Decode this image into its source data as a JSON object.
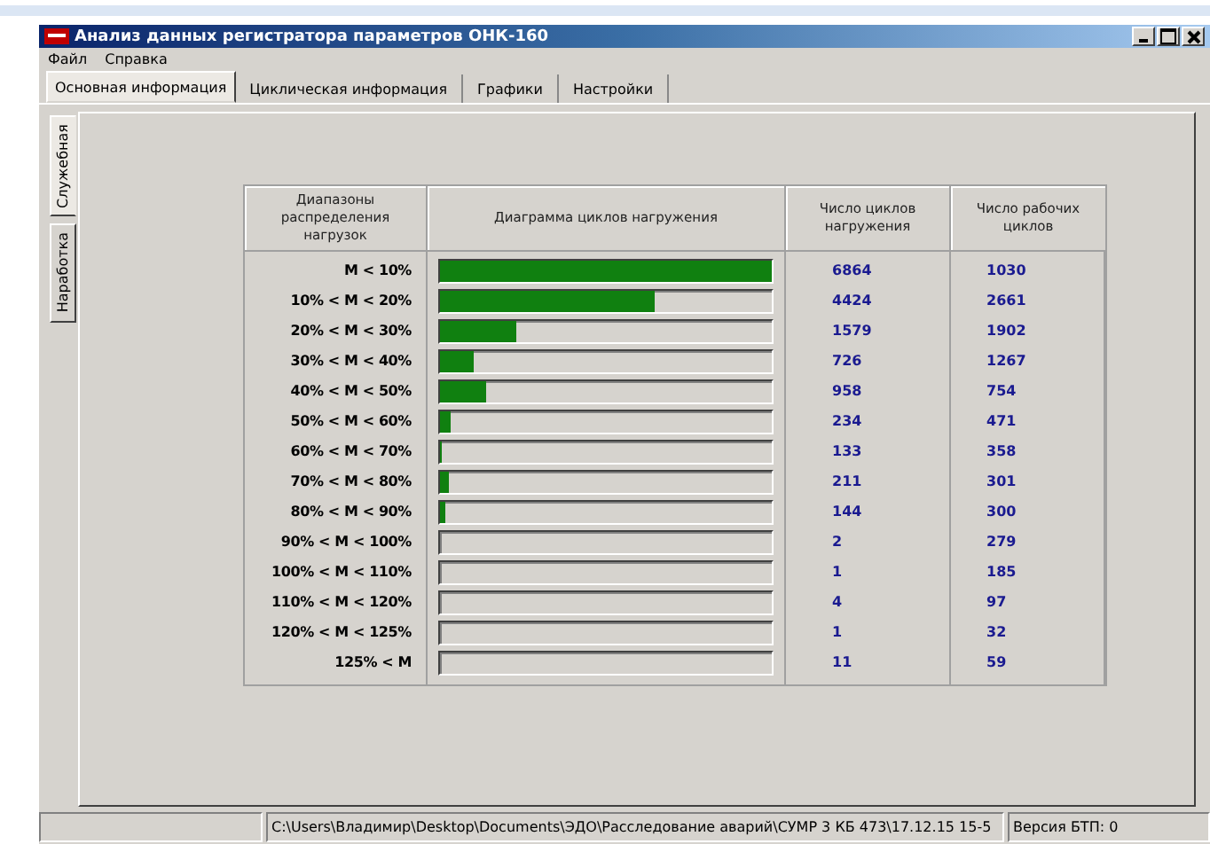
{
  "window": {
    "title": "Анализ данных регистратора параметров ОНК-160"
  },
  "menu": [
    "Файл",
    "Справка"
  ],
  "tabs": [
    {
      "label": "Основная информация",
      "selected": true
    },
    {
      "label": "Цикличеcкая информация",
      "selected": false
    },
    {
      "label": "Графики",
      "selected": false
    },
    {
      "label": "Настройки",
      "selected": false
    }
  ],
  "side_tabs": [
    {
      "label": "Служебная",
      "selected": true
    },
    {
      "label": "Наработка",
      "selected": false
    }
  ],
  "table": {
    "columns": [
      "Диапазоны распределения нагрузок",
      "Диаграмма циклов нагружения",
      "Число циклов нагружения",
      "Число рабочих циклов"
    ],
    "rows": [
      {
        "range": "M < 10%",
        "level": 1,
        "cycles": "6864",
        "work": "1030"
      },
      {
        "range": "10% < M < 20%",
        "level": 0.645,
        "cycles": "4424",
        "work": "2661"
      },
      {
        "range": "20% < M < 30%",
        "level": 0.23,
        "cycles": "1579",
        "work": "1902"
      },
      {
        "range": "30% < M < 40%",
        "level": 0.1,
        "cycles": "726",
        "work": "1267"
      },
      {
        "range": "40% < M < 50%",
        "level": 0.14,
        "cycles": "958",
        "work": "754"
      },
      {
        "range": "50% < M < 60%",
        "level": 0.03,
        "cycles": "234",
        "work": "471"
      },
      {
        "range": "60% < M < 70%",
        "level": 0.005,
        "cycles": "133",
        "work": "358"
      },
      {
        "range": "70% < M < 80%",
        "level": 0.025,
        "cycles": "211",
        "work": "301"
      },
      {
        "range": "80% < M < 90%",
        "level": 0.015,
        "cycles": "144",
        "work": "300"
      },
      {
        "range": "90% < M < 100%",
        "level": 0,
        "cycles": "2",
        "work": "279"
      },
      {
        "range": "100% < M < 110%",
        "level": 0,
        "cycles": "1",
        "work": "185"
      },
      {
        "range": "110% < M < 120%",
        "level": 0,
        "cycles": "4",
        "work": "97"
      },
      {
        "range": "120% < M < 125%",
        "level": 0,
        "cycles": "1",
        "work": "32"
      },
      {
        "range": "125% < M",
        "level": 0,
        "cycles": "11",
        "work": "59"
      }
    ]
  },
  "status_bar": [
    "C:\\Users\\Владимир\\Desktop\\Documents\\ЭДО\\Расследование аварий\\СУМР 3 КБ 473\\17.12.15 15-5",
    "Версия БТП: 0"
  ]
}
